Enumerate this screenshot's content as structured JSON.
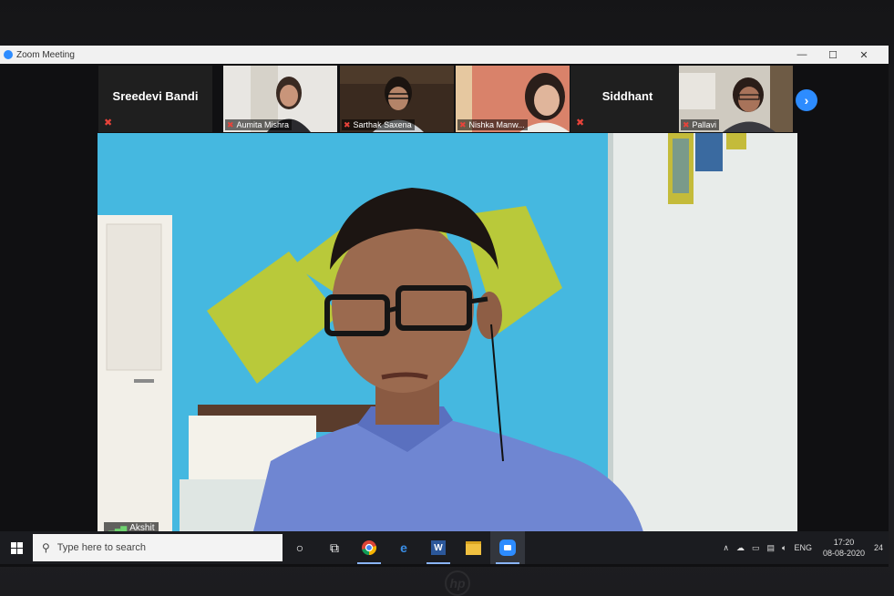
{
  "window": {
    "title": "Zoom Meeting",
    "minimize": "—",
    "maximize": "☐",
    "close": "✕"
  },
  "gallery": {
    "tiles": [
      {
        "name": "Sreedevi Bandi",
        "type": "name-only"
      },
      {
        "name": "Aumita Mishra",
        "type": "video"
      },
      {
        "name": "Sarthak Saxena",
        "type": "video"
      },
      {
        "name": "Nishka Manw...",
        "type": "video"
      },
      {
        "name": "Siddhant",
        "type": "name-only"
      },
      {
        "name": "Pallavi",
        "type": "video"
      }
    ],
    "next_icon": "chevron-right-icon"
  },
  "speaker": {
    "name": "Akshit"
  },
  "taskbar": {
    "search_placeholder": "Type here to search",
    "language": "ENG",
    "time": "17:20",
    "date": "08-08-2020",
    "notification_count": "24"
  },
  "colors": {
    "zoom_blue": "#2d8cff",
    "mute_red": "#e8433a",
    "wall_blue": "#45b8e0",
    "wall_green": "#b9c93a"
  }
}
